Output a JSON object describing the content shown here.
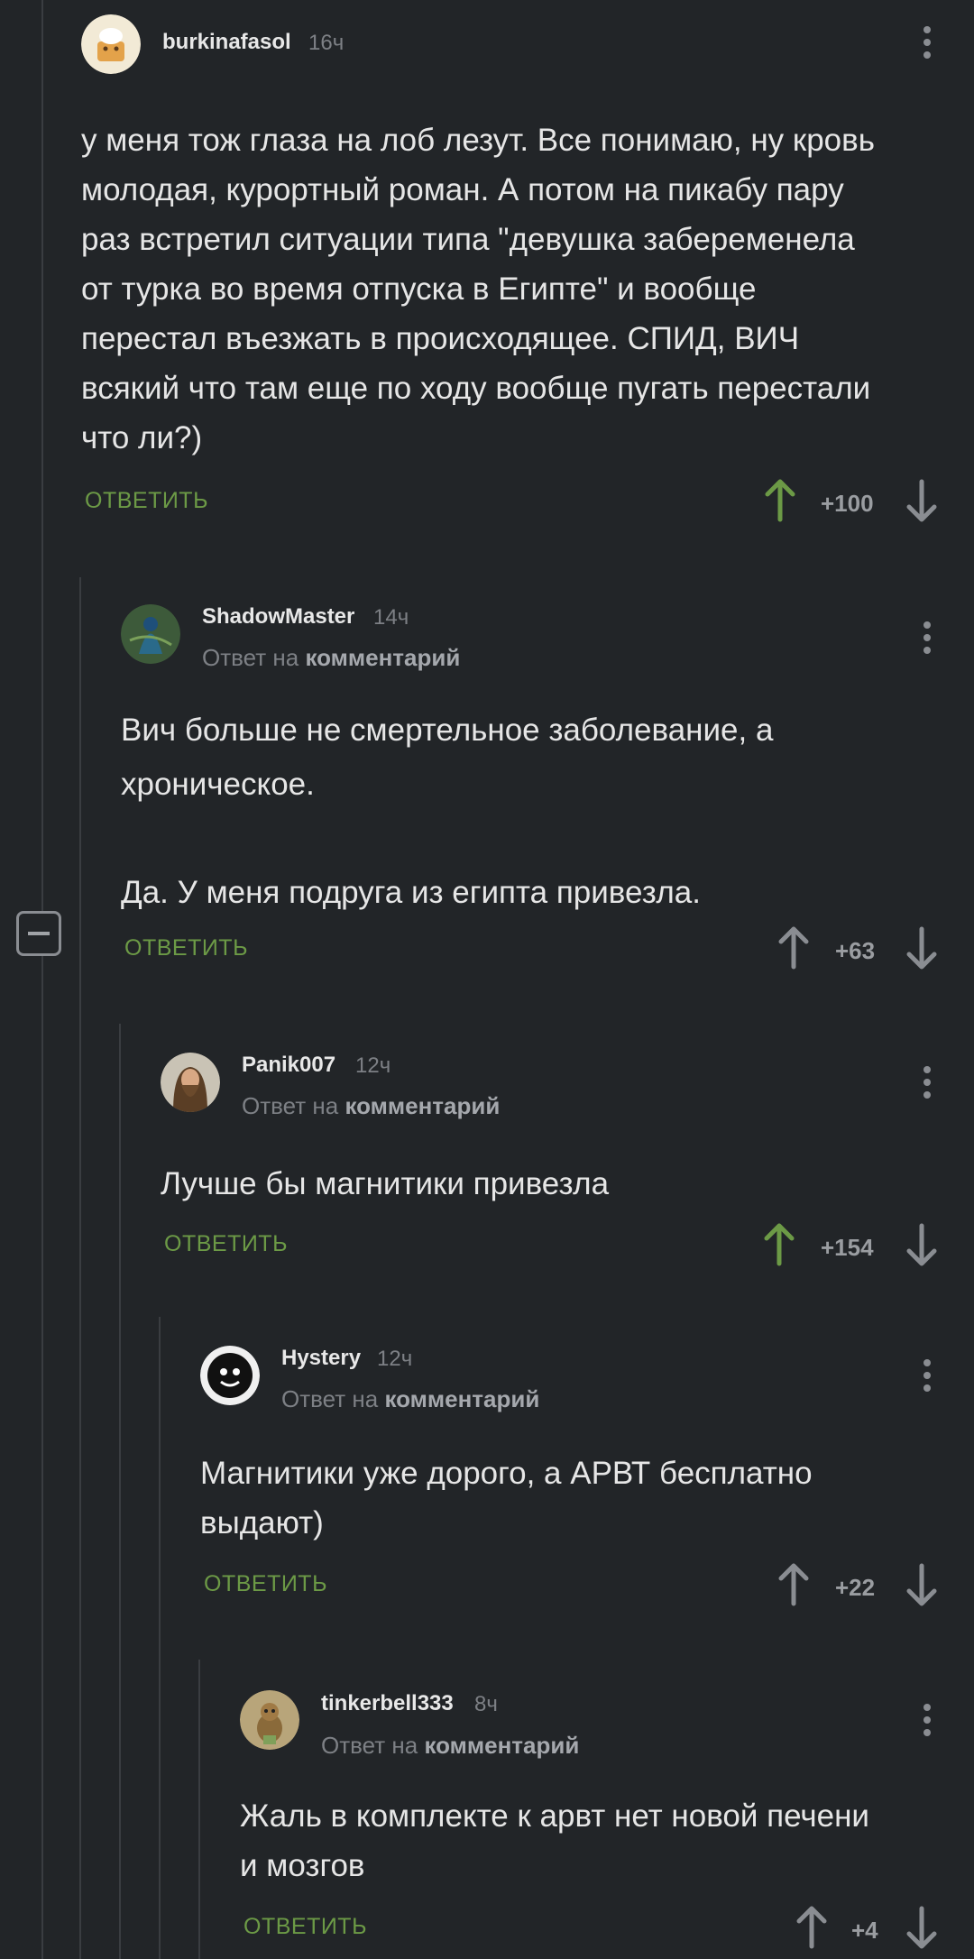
{
  "comments": [
    {
      "author": "burkinafasol",
      "time": "16ч",
      "reply_prefix": "",
      "reply_target": "",
      "text": "у меня тож глаза на лоб лезут. Все понимаю, ну кровь\nмолодая, курортный роман. А потом на пикабу пару\nраз встретил ситуации типа \"девушка забеременела\nот турка во время отпуска в Египте\" и вообще\nперестал въезжать в происходящее. СПИД, ВИЧ\nвсякий что там еще по ходу вообще пугать перестали\nчто ли?)",
      "reply_label": "ОТВЕТИТЬ",
      "score": "+100",
      "upvoted": true
    },
    {
      "author": "ShadowMaster",
      "time": "14ч",
      "reply_prefix": "Ответ на ",
      "reply_target": "комментарий",
      "text": "Вич больше не смертельное заболевание, а\nхроническое.\n\nДа. У меня подруга из египта привезла.",
      "reply_label": "ОТВЕТИТЬ",
      "score": "+63",
      "upvoted": false
    },
    {
      "author": "Panik007",
      "time": "12ч",
      "reply_prefix": "Ответ на ",
      "reply_target": "комментарий",
      "text": "Лучше бы магнитики привезла",
      "reply_label": "ОТВЕТИТЬ",
      "score": "+154",
      "upvoted": true
    },
    {
      "author": "Hystery",
      "time": "12ч",
      "reply_prefix": "Ответ на ",
      "reply_target": "комментарий",
      "text": "Магнитики уже дорого, а АРВТ бесплатно\nвыдают)",
      "reply_label": "ОТВЕТИТЬ",
      "score": "+22",
      "upvoted": false
    },
    {
      "author": "tinkerbell333",
      "time": "8ч",
      "reply_prefix": "Ответ на ",
      "reply_target": "комментарий",
      "text": "Жаль в комплекте к арвт нет новой печени\nи мозгов",
      "reply_label": "ОТВЕТИТЬ",
      "score": "+4",
      "upvoted": false
    }
  ],
  "colors": {
    "background": "#222528",
    "reply_green": "#6c9a46",
    "upvote_active": "#6c9a46",
    "vote_inactive": "#8a8d92"
  },
  "icons": [
    "more-vertical-icon",
    "arrow-up-icon",
    "arrow-down-icon",
    "collapse-minus-icon"
  ]
}
